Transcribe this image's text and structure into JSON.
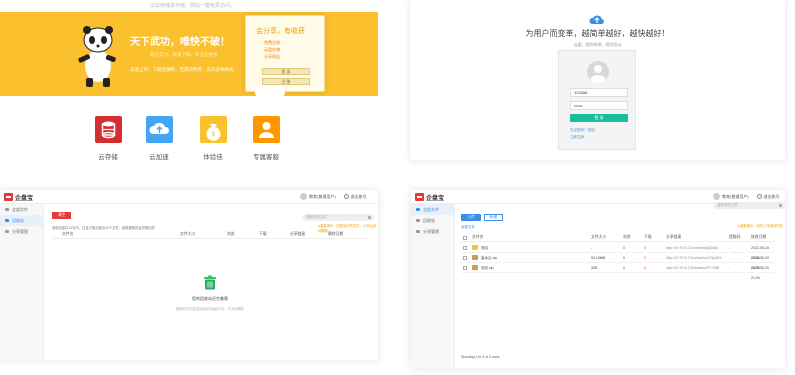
{
  "landing": {
    "top_tag": "以云存储来存储，网站一键免费访问。",
    "slogan": "天下武功，唯快不破！",
    "subtitle": "超凡实力，极速下载，专业云服务",
    "description": "高速上传、下载无限制，无限次秒传，支持多种格式",
    "card": {
      "title": "会分享，有收获",
      "items": [
        "免费注册",
        "云盘存储",
        "分享收益"
      ],
      "login_label": "登 录",
      "register_label": "注 册"
    },
    "features": [
      {
        "label": "云存储",
        "color": "#d32f2f",
        "icon": "database-icon"
      },
      {
        "label": "云加速",
        "color": "#42a5f5",
        "icon": "cloud-upload-icon"
      },
      {
        "label": "体验佳",
        "color": "#fbc02d",
        "icon": "money-bag-icon"
      },
      {
        "label": "专属客服",
        "color": "#ff9800",
        "icon": "support-agent-icon"
      }
    ]
  },
  "login": {
    "title": "为用户而变革，越简单越好，越快越好！",
    "subtitle": "云盘，随你所想，随你而动",
    "username_value": "123456",
    "password_value": "••••••",
    "login_button": "登 录",
    "links": [
      "忘记密码？找回",
      "立即注册"
    ],
    "footer_dots": "· · · · · · · · · · · · · ·"
  },
  "app_common": {
    "brand": "企盘宝",
    "user": "教育(普通用户)",
    "logout": "退出账号",
    "search_placeholder": "搜索您的文件",
    "sidebar": [
      "全部文件",
      "回收站",
      "分享管理"
    ]
  },
  "recycle": {
    "clear_button": "清空",
    "notice": "回收站保存10天内，并且只保存最近10个文件，最新删除的会挤掉旧的",
    "tip": "●温馨提示：回收站中的文件，10天后自动删除",
    "columns": [
      "文件名",
      "文件大小",
      "浏览",
      "下载",
      "分享链接",
      "删除日期"
    ],
    "empty_title": "您的回收站还空着哦",
    "empty_sub": "删除的文件会在回收站中保留10天，10天后删除"
  },
  "files": {
    "upload_button": "上传",
    "new_folder_button": "新建",
    "breadcrumb": "全部文件",
    "tip": "●温馨提示：请勿上传违法内容",
    "columns": [
      "文件名",
      "文件大小",
      "浏览",
      "下载",
      "分享链接",
      "提取码",
      "修改日期"
    ],
    "rows": [
      {
        "name": "测试",
        "size": "-",
        "views": "0",
        "downloads": "0",
        "link": "http://47.97.5.174/share/s/jQ3ABI",
        "code": "-",
        "date": "2022-06-15 17:44",
        "type": "folder",
        "icon_color": "#f5c242"
      },
      {
        "name": "高木云.zip",
        "size": "90.16MB",
        "views": "0",
        "downloads": "0",
        "link": "http://47.97.5.174/share/s/vFQa2Ee",
        "code": "-",
        "date": "2022-06-20 21:33",
        "type": "zip",
        "icon_color": "#c89b5a"
      },
      {
        "name": "测试.zip",
        "size": "32B",
        "views": "0",
        "downloads": "0",
        "link": "http://47.97.5.174/share/s/FF72ffN",
        "code": "-",
        "date": "2022-06-20 21:34",
        "type": "zip",
        "icon_color": "#c89b5a"
      }
    ],
    "footer": "Showing 1 to 3 of 3 rows"
  }
}
